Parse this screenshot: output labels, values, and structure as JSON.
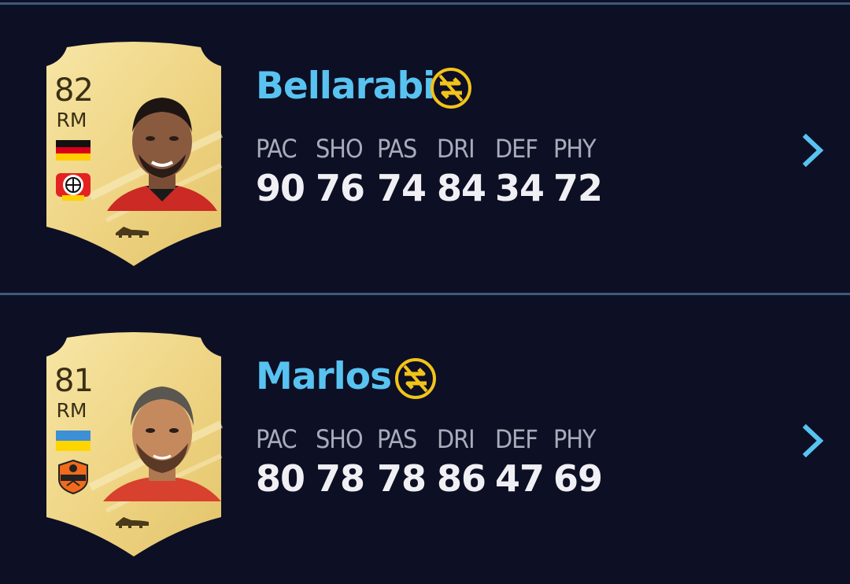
{
  "colors": {
    "background": "#0d0f24",
    "divider": "#3d5a7a",
    "name": "#58c3f0",
    "stat_label": "#a8abba",
    "stat_value": "#f0f0f4",
    "untradeable_badge": "#f2c31a",
    "card_gold": "#f1dc93"
  },
  "players": [
    {
      "name": "Bellarabi",
      "rating": "82",
      "position": "RM",
      "nation_flag": "germany-flag",
      "club_badge": "leverkusen-badge",
      "untradeable_icon": "untradeable-icon",
      "stats": [
        {
          "label": "PAC",
          "value": "90"
        },
        {
          "label": "SHO",
          "value": "76"
        },
        {
          "label": "PAS",
          "value": "74"
        },
        {
          "label": "DRI",
          "value": "84"
        },
        {
          "label": "DEF",
          "value": "34"
        },
        {
          "label": "PHY",
          "value": "72"
        }
      ],
      "action_icon": "chevron-right-icon"
    },
    {
      "name": "Marlos",
      "rating": "81",
      "position": "RM",
      "nation_flag": "ukraine-flag",
      "club_badge": "shakhtar-badge",
      "untradeable_icon": "untradeable-icon",
      "stats": [
        {
          "label": "PAC",
          "value": "80"
        },
        {
          "label": "SHO",
          "value": "78"
        },
        {
          "label": "PAS",
          "value": "78"
        },
        {
          "label": "DRI",
          "value": "86"
        },
        {
          "label": "DEF",
          "value": "47"
        },
        {
          "label": "PHY",
          "value": "69"
        }
      ],
      "action_icon": "chevron-right-icon"
    }
  ]
}
